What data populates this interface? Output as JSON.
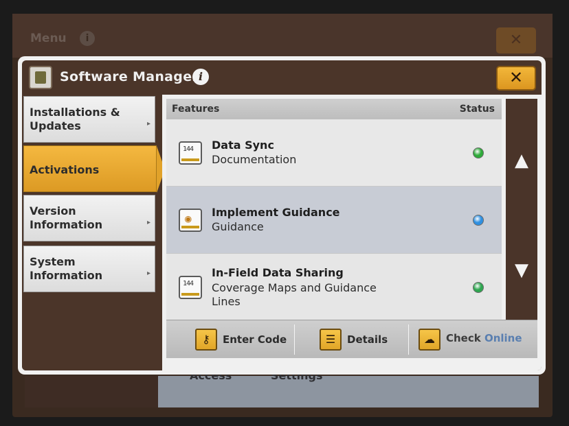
{
  "background": {
    "menu_label": "Menu",
    "info_glyph": "i",
    "close_glyph": "✕",
    "bottom_labels": [
      "Access",
      "Settings"
    ]
  },
  "dialog": {
    "title": "Software Manager",
    "info_glyph": "i",
    "close_glyph": "✕",
    "accent_color": "#e9a62c"
  },
  "sidebar": {
    "items": [
      {
        "label": "Installations & Updates",
        "active": false
      },
      {
        "label": "Activations",
        "active": true
      },
      {
        "label": "Version Information",
        "active": false
      },
      {
        "label": "System Information",
        "active": false
      }
    ],
    "chevron": "▸"
  },
  "list": {
    "header_features": "Features",
    "header_status": "Status",
    "rows": [
      {
        "title": "Data Sync",
        "subtitle": "Documentation",
        "icon": "counter-display-icon",
        "glyph": "144",
        "status_color": "#2faa3a",
        "selected": false
      },
      {
        "title": "Implement Guidance",
        "subtitle": "Guidance",
        "icon": "guidance-target-icon",
        "glyph": "◉",
        "status_color": "#2f8fe0",
        "selected": true
      },
      {
        "title": "In-Field Data Sharing",
        "subtitle": "Coverage Maps and Guidance Lines",
        "icon": "counter-display-icon",
        "glyph": "144",
        "status_color": "#2fa650",
        "selected": false
      }
    ]
  },
  "scroll": {
    "up_glyph": "▲",
    "down_glyph": "▼"
  },
  "toolbar": {
    "enter_code_label": "Enter Code",
    "enter_code_glyph": "⚷",
    "details_label": "Details",
    "details_glyph": "☰",
    "check_label": "Check",
    "online_label": "Online",
    "check_online_glyph": "☁"
  }
}
